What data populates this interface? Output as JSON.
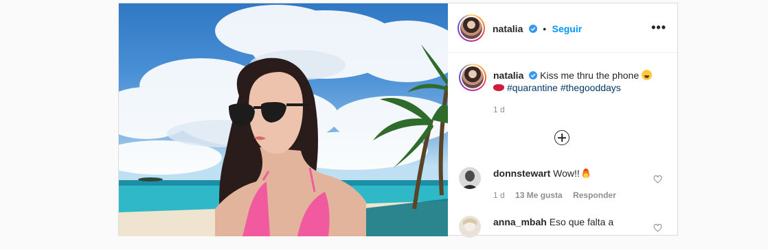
{
  "post": {
    "author": "natalia",
    "follow_label": "Seguir",
    "separator": "•",
    "more_label": "•••",
    "caption": {
      "username": "natalia",
      "text": "Kiss me thru the phone",
      "hashtags": [
        "#quarantine",
        "#thegooddays"
      ],
      "time": "1 d"
    },
    "load_more_icon": "plus-circle-icon",
    "comments": [
      {
        "username": "donnstewart",
        "text": "Wow!!",
        "time": "1 d",
        "likes": "13 Me gusta",
        "reply": "Responder"
      },
      {
        "username": "anna_mbah",
        "text": "Eso que falta a"
      }
    ]
  },
  "colors": {
    "accent": "#0095f6",
    "hashtag": "#00376b",
    "muted": "#8e8e8e",
    "text": "#262626",
    "verified": "#3897f0"
  }
}
